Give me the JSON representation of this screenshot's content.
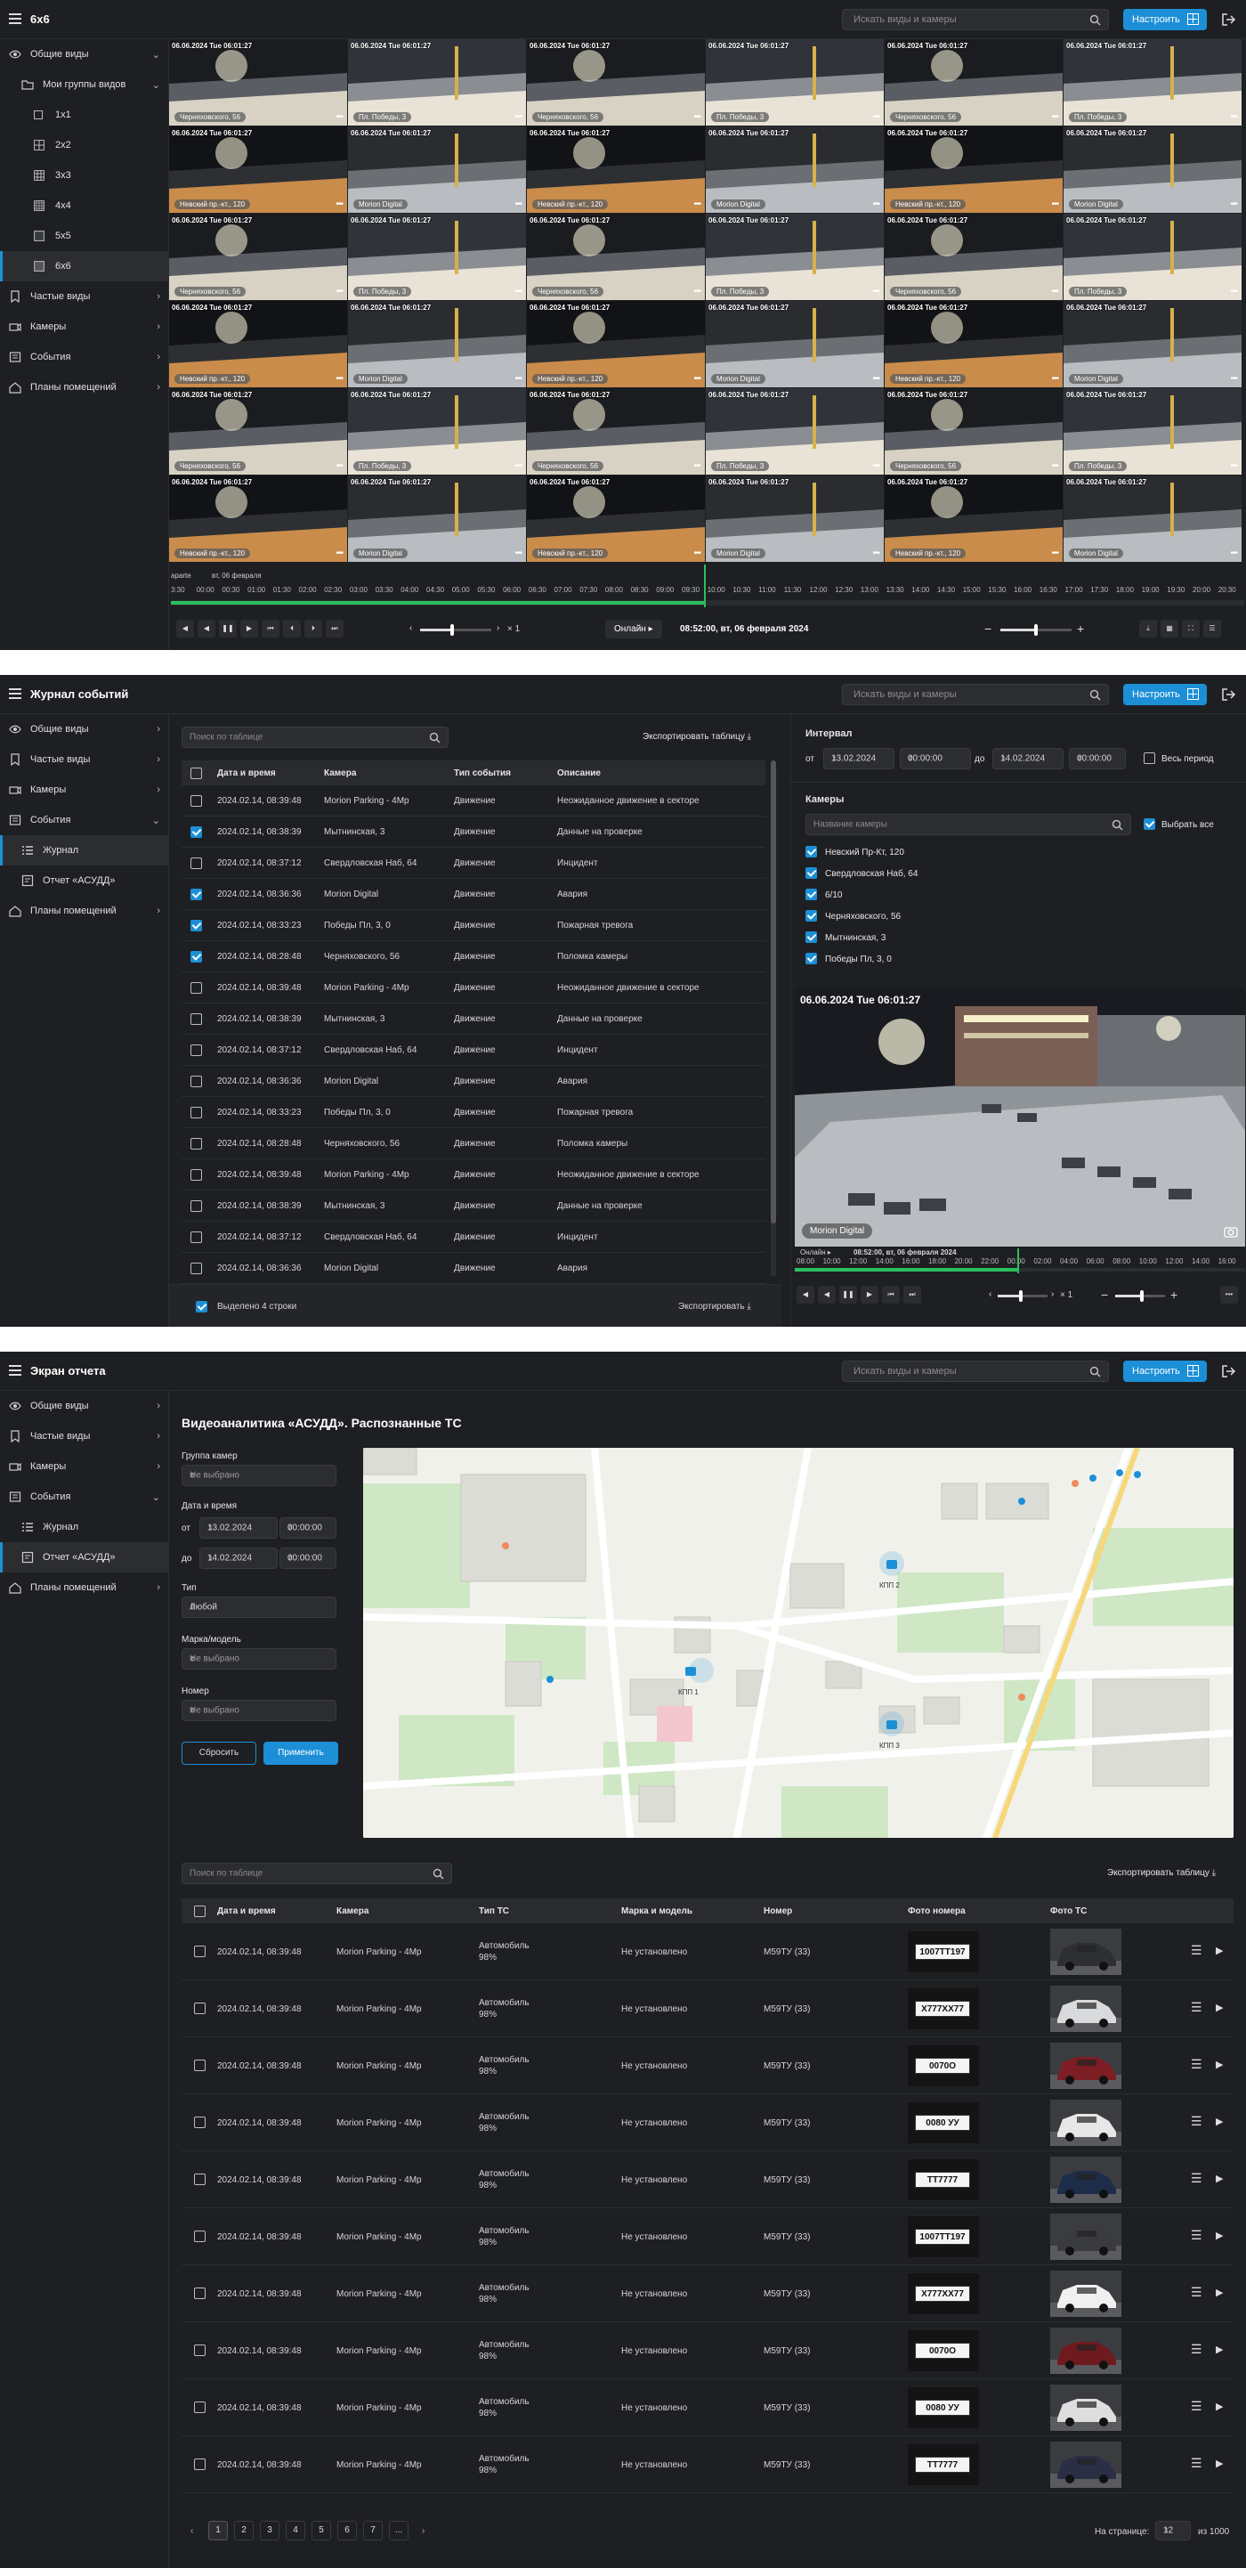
{
  "s1": {
    "title": "6x6",
    "search_placeholder": "Искать виды и камеры",
    "configure_label": "Настроить",
    "sidebar": {
      "general_views": "Общие виды",
      "my_groups": "Мои группы видов",
      "layouts": [
        "1x1",
        "2x2",
        "3x3",
        "4x4",
        "5x5",
        "6x6"
      ],
      "frequent_views": "Частые виды",
      "cameras": "Камеры",
      "events": "События",
      "floor_plans": "Планы помещений"
    },
    "tile_timestamp": "06.06.2024 Tue 06:01:27",
    "camera_names": [
      "Черняховского, 56",
      "Пл. Победы, 3",
      "Черняховского, 56",
      "Пл. Победы, 3",
      "Черняховского, 56",
      "Пл. Победы, 3",
      "Невский пр.-кт., 120",
      "Morion Digital",
      "Невский пр.-кт., 120",
      "Morion Digital",
      "Невский пр.-кт., 120",
      "Morion Digital"
    ],
    "timeline": {
      "date_labels": [
        "aparte",
        "вт, 06 февраля"
      ],
      "ticks": [
        "3:30",
        "00:00",
        "00:30",
        "01:00",
        "01:30",
        "02:00",
        "02:30",
        "03:00",
        "03:30",
        "04:00",
        "04:30",
        "05:00",
        "05:30",
        "06:00",
        "06:30",
        "07:00",
        "07:30",
        "08:00",
        "08:30",
        "09:00",
        "09:30",
        "10:00",
        "10:30",
        "11:00",
        "11:30",
        "12:00",
        "12:30",
        "13:00",
        "13:30",
        "14:00",
        "14:30",
        "15:00",
        "15:30",
        "16:00",
        "16:30",
        "17:00",
        "17:30",
        "18:00",
        "19:00",
        "19:30",
        "20:00",
        "20:30"
      ],
      "speed": "× 1",
      "online_label": "Онлайн",
      "datetime": "08:52:00, вт, 06 февраля 2024"
    }
  },
  "s2": {
    "title": "Журнал событий",
    "search_placeholder": "Искать виды и камеры",
    "configure_label": "Настроить",
    "sidebar": {
      "general_views": "Общие виды",
      "frequent_views": "Частые виды",
      "cameras": "Камеры",
      "events": "События",
      "journal": "Журнал",
      "report": "Отчет «АСУДД»",
      "floor_plans": "Планы помещений"
    },
    "table_search_placeholder": "Поиск по таблице",
    "export_table": "Экспортировать таблицу",
    "columns": [
      "Дата и время",
      "Камера",
      "Тип события",
      "Описание"
    ],
    "rows": [
      {
        "checked": false,
        "dt": "2024.02.14, 08:39:48",
        "camera": "Morion Parking - 4Mp",
        "type": "Движение",
        "desc": "Неожиданное движение в секторе"
      },
      {
        "checked": true,
        "dt": "2024.02.14, 08:38:39",
        "camera": "Мытнинская, 3",
        "type": "Движение",
        "desc": "Данные на проверке"
      },
      {
        "checked": false,
        "dt": "2024.02.14, 08:37:12",
        "camera": "Свердловская Наб, 64",
        "type": "Движение",
        "desc": "Инцидент"
      },
      {
        "checked": true,
        "dt": "2024.02.14, 08:36:36",
        "camera": "Morion Digital",
        "type": "Движение",
        "desc": "Авария"
      },
      {
        "checked": true,
        "dt": "2024.02.14, 08:33:23",
        "camera": "Победы Пл, 3, 0",
        "type": "Движение",
        "desc": "Пожарная тревога"
      },
      {
        "checked": true,
        "dt": "2024.02.14, 08:28:48",
        "camera": "Черняховского, 56",
        "type": "Движение",
        "desc": "Поломка камеры"
      },
      {
        "checked": false,
        "dt": "2024.02.14, 08:39:48",
        "camera": "Morion Parking - 4Mp",
        "type": "Движение",
        "desc": "Неожиданное движение в секторе"
      },
      {
        "checked": false,
        "dt": "2024.02.14, 08:38:39",
        "camera": "Мытнинская, 3",
        "type": "Движение",
        "desc": "Данные на проверке"
      },
      {
        "checked": false,
        "dt": "2024.02.14, 08:37:12",
        "camera": "Свердловская Наб, 64",
        "type": "Движение",
        "desc": "Инцидент"
      },
      {
        "checked": false,
        "dt": "2024.02.14, 08:36:36",
        "camera": "Morion Digital",
        "type": "Движение",
        "desc": "Авария"
      },
      {
        "checked": false,
        "dt": "2024.02.14, 08:33:23",
        "camera": "Победы Пл, 3, 0",
        "type": "Движение",
        "desc": "Пожарная тревога"
      },
      {
        "checked": false,
        "dt": "2024.02.14, 08:28:48",
        "camera": "Черняховского, 56",
        "type": "Движение",
        "desc": "Поломка камеры"
      },
      {
        "checked": false,
        "dt": "2024.02.14, 08:39:48",
        "camera": "Morion Parking - 4Mp",
        "type": "Движение",
        "desc": "Неожиданное движение в секторе"
      },
      {
        "checked": false,
        "dt": "2024.02.14, 08:38:39",
        "camera": "Мытнинская, 3",
        "type": "Движение",
        "desc": "Данные на проверке"
      },
      {
        "checked": false,
        "dt": "2024.02.14, 08:37:12",
        "camera": "Свердловская Наб, 64",
        "type": "Движение",
        "desc": "Инцидент"
      },
      {
        "checked": false,
        "dt": "2024.02.14, 08:36:36",
        "camera": "Morion Digital",
        "type": "Движение",
        "desc": "Авария"
      }
    ],
    "selected_text": "Выделено 4 строки",
    "export": "Экспортировать",
    "interval": {
      "title": "Интервал",
      "from": "от",
      "to": "до",
      "from_date": "13.02.2024",
      "from_time": "00:00:00",
      "to_date": "14.02.2024",
      "to_time": "00:00:00",
      "whole_period": "Весь период"
    },
    "cameras_panel": {
      "title": "Камеры",
      "placeholder": "Название камеры",
      "select_all": "Выбрать все",
      "items": [
        "Невский Пр-Кт, 120",
        "Свердловская Наб, 64",
        "6/10",
        "Черняховского, 56",
        "Мытнинская, 3",
        "Победы Пл, 3, 0"
      ]
    },
    "preview": {
      "timestamp": "06.06.2024 Tue 06:01:27",
      "camera": "Morion Digital",
      "online_label": "Онлайн",
      "datetime": "08:52:00, вт, 06 февраля 2024",
      "ticks": [
        "08:00",
        "10:00",
        "12:00",
        "14:00",
        "16:00",
        "18:00",
        "20:00",
        "22:00",
        "00:00",
        "02:00",
        "04:00",
        "06:00",
        "08:00",
        "10:00",
        "12:00",
        "14:00",
        "16:00"
      ],
      "speed": "× 1"
    }
  },
  "s3": {
    "title": "Экран отчета",
    "search_placeholder": "Искать виды и камеры",
    "configure_label": "Настроить",
    "sidebar": {
      "general_views": "Общие виды",
      "frequent_views": "Частые виды",
      "cameras": "Камеры",
      "events": "События",
      "journal": "Журнал",
      "report": "Отчет «АСУДД»",
      "floor_plans": "Планы помещений"
    },
    "heading": "Видеоаналитика «АСУДД». Распознанные ТС",
    "filters": {
      "camera_group": "Группа камер",
      "not_selected": "Не выбрано",
      "date_time": "Дата и время",
      "from": "от",
      "to": "до",
      "from_date": "13.02.2024",
      "from_time": "00:00:00",
      "to_date": "14.02.2024",
      "to_time": "00:00:00",
      "type": "Тип",
      "type_value": "Любой",
      "brand": "Марка/модель",
      "number": "Номер",
      "reset": "Сбросить",
      "apply": "Применить"
    },
    "map_labels": [
      "КПП 1",
      "КПП 2",
      "КПП 3"
    ],
    "table_search_placeholder": "Поиск по таблице",
    "export_table": "Экспортировать таблицу",
    "columns": [
      "Дата и время",
      "Камера",
      "Тип ТС",
      "Марка и модель",
      "Номер",
      "Фото номера",
      "Фото ТС"
    ],
    "row_common": {
      "dt": "2024.02.14, 08:39:48",
      "camera": "Morion Parking - 4Mp",
      "type_line1": "Автомобиль",
      "type_line2": "98%",
      "brand": "Не установлено",
      "number": "М59ТУ (33)"
    },
    "plates": [
      "1007ТТ197",
      "Х777ХХ77",
      "0070О",
      "0080 УУ",
      "ТТ7777",
      "1007ТТ197",
      "Х777ХХ77",
      "0070О",
      "0080 УУ",
      "ТТ7777"
    ],
    "pagination": {
      "pages": [
        "1",
        "2",
        "3",
        "4",
        "5",
        "6",
        "7",
        "..."
      ],
      "per_page_label": "На странице:",
      "per_page": "12",
      "of_total": "из 1000"
    }
  }
}
